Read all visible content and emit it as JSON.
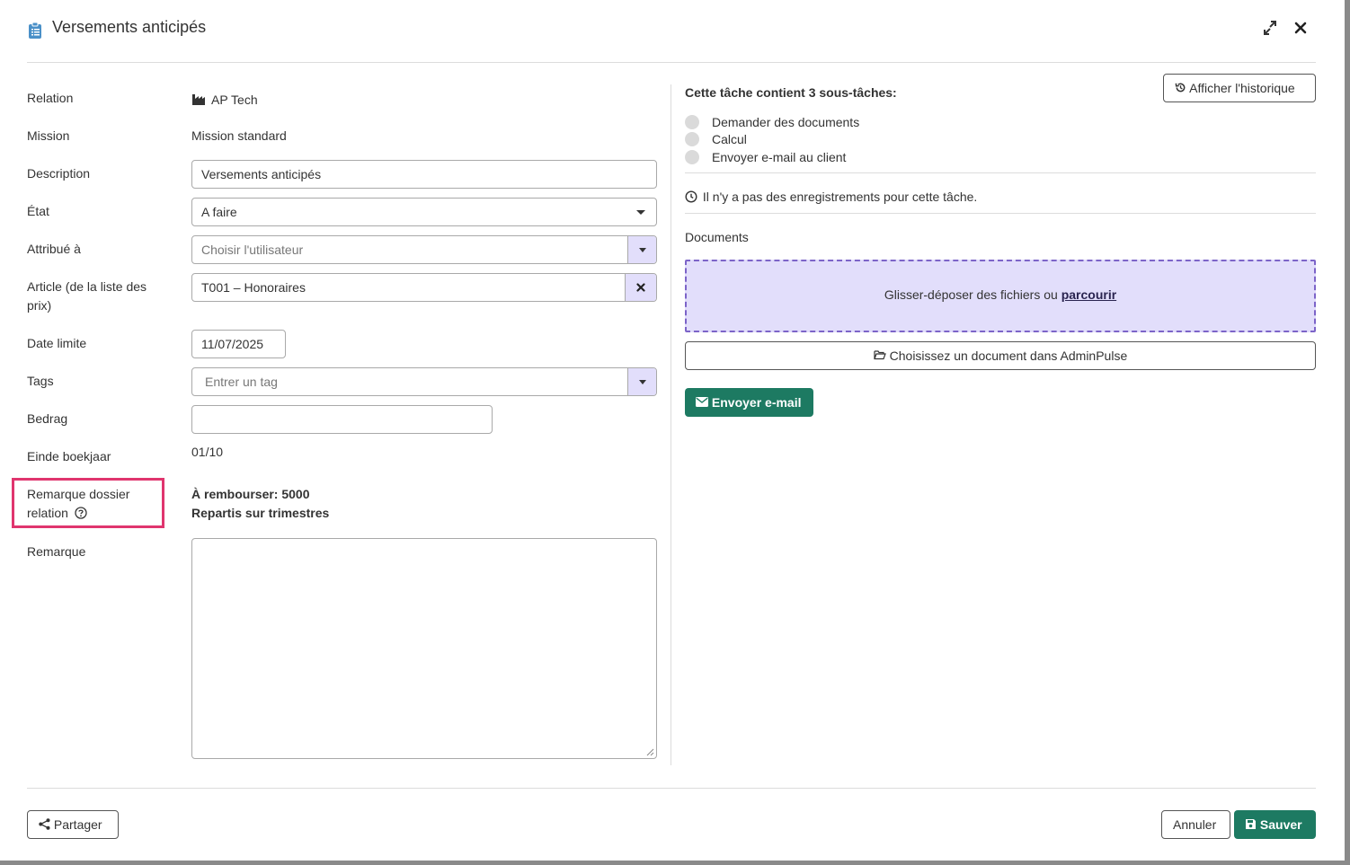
{
  "modal": {
    "title": "Versements anticipés"
  },
  "form": {
    "relation_label": "Relation",
    "relation_value": "AP Tech",
    "mission_label": "Mission",
    "mission_value": "Mission standard",
    "description_label": "Description",
    "description_value": "Versements anticipés",
    "etat_label": "État",
    "etat_value": "A faire",
    "attribue_label": "Attribué à",
    "attribue_placeholder": "Choisir l'utilisateur",
    "article_label": "Article (de la liste des prix)",
    "article_value": "T001 – Honoraires",
    "date_label": "Date limite",
    "date_value": "11/07/2025",
    "tags_label": "Tags",
    "tags_placeholder": "Entrer un tag",
    "bedrag_label": "Bedrag",
    "bedrag_value": "",
    "einde_label": "Einde boekjaar",
    "einde_value": "01/10",
    "remarque_dossier_label": "Remarque dossier relation",
    "remarque_dossier_line1": "À rembourser: 5000",
    "remarque_dossier_line2": "Repartis sur trimestres",
    "remarque_label": "Remarque",
    "remarque_value": ""
  },
  "right": {
    "history_button": "Afficher l'historique",
    "subtasks_heading": "Cette tâche contient 3 sous-tâches:",
    "subtasks": [
      "Demander des documents",
      "Calcul",
      "Envoyer e-mail au client"
    ],
    "no_records": "Il n'y a pas des enregistrements pour cette tâche.",
    "documents_label": "Documents",
    "dropzone_text": "Glisser-déposer des fichiers ou",
    "dropzone_browse": "parcourir",
    "choose_document_button": "Choisissez un document dans AdminPulse",
    "send_email_button": "Envoyer e-mail"
  },
  "footer": {
    "share_button": "Partager",
    "cancel_button": "Annuler",
    "save_button": "Sauver"
  },
  "colors": {
    "accent_green": "#1d7a62",
    "dropzone_bg": "#e2defb",
    "highlight": "#e0356e",
    "title_icon": "#4a90c8"
  }
}
